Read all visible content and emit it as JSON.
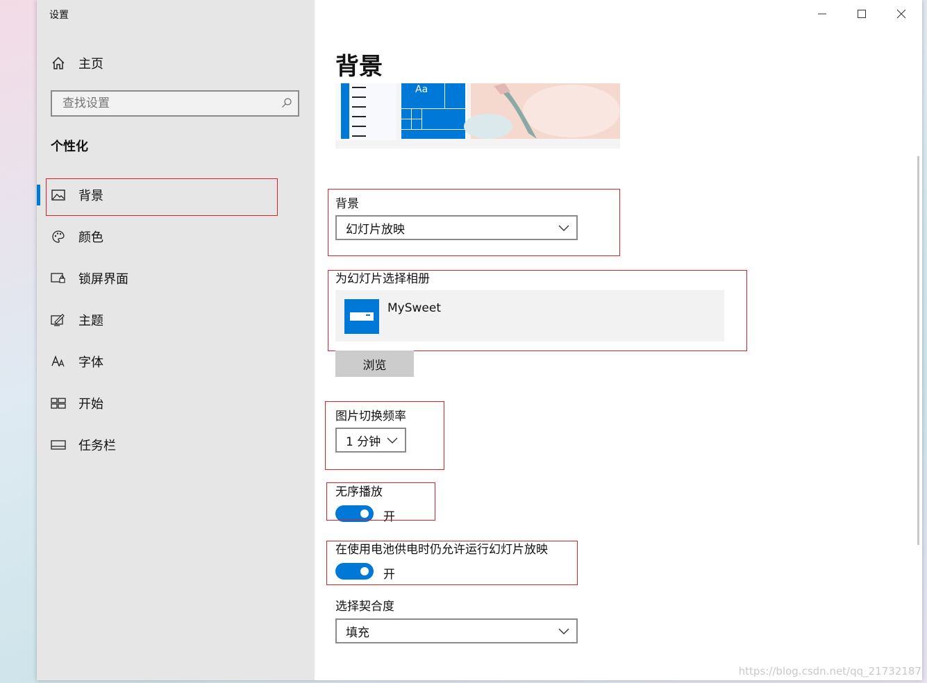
{
  "window": {
    "title": "设置"
  },
  "sidebar": {
    "home_label": "主页",
    "search_placeholder": "查找设置",
    "section_title": "个性化",
    "items": [
      {
        "label": "背景",
        "icon": "image-icon",
        "active": true
      },
      {
        "label": "颜色",
        "icon": "palette-icon"
      },
      {
        "label": "锁屏界面",
        "icon": "lock-screen-icon"
      },
      {
        "label": "主题",
        "icon": "theme-icon"
      },
      {
        "label": "字体",
        "icon": "font-icon"
      },
      {
        "label": "开始",
        "icon": "start-icon"
      },
      {
        "label": "任务栏",
        "icon": "taskbar-icon"
      }
    ]
  },
  "main": {
    "title": "背景",
    "preview_sample_text": "Aa",
    "background": {
      "label": "背景",
      "value": "幻灯片放映"
    },
    "album": {
      "label": "为幻灯片选择相册",
      "name": "MySweet"
    },
    "browse_label": "浏览",
    "frequency": {
      "label": "图片切换频率",
      "value": "1 分钟"
    },
    "shuffle": {
      "label": "无序播放",
      "state": "开"
    },
    "battery": {
      "label": "在使用电池供电时仍允许运行幻灯片放映",
      "state": "开"
    },
    "fit": {
      "label": "选择契合度",
      "value": "填充"
    }
  },
  "colors": {
    "accent": "#0078d7",
    "annotation": "#e02020",
    "sidebar_bg": "#e6e6e6"
  },
  "watermark": "https://blog.csdn.net/qq_21732187"
}
